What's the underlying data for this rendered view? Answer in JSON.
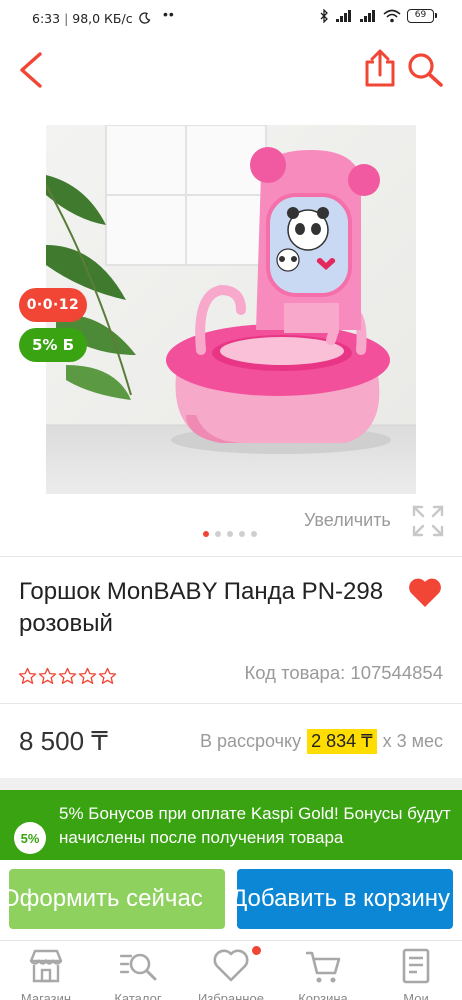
{
  "status_bar": {
    "time": "6:33",
    "network_speed": "98,0 КБ/с",
    "more": "••",
    "battery": "69"
  },
  "product": {
    "title": "Горшок MonBABY Панда PN-298 розовый",
    "sku": "Код товара: 107544854",
    "price": "8 500 ₸",
    "installment_prefix": "В рассрочку",
    "installment_amount": "2 834 ₸",
    "installment_suffix": "х 3 мес",
    "rating_stars": 0,
    "is_favorite": true
  },
  "gallery": {
    "badge_installment": "0·0·12",
    "badge_bonus": "5% Б",
    "zoom_label": "Увеличить",
    "image_count": 5,
    "active_index": 0
  },
  "bonus_banner": {
    "badge": "5%",
    "text": "5% Бонусов при оплате Kaspi Gold! Бонусы будут начислены после получения товара"
  },
  "actions": {
    "buy_now": "Оформить сейчас",
    "add_to_cart": "Добавить в корзину"
  },
  "bottom_nav": {
    "items": [
      {
        "label": "Магазин",
        "icon": "shop-icon"
      },
      {
        "label": "Каталог",
        "icon": "catalog-icon"
      },
      {
        "label": "Избранное",
        "icon": "heart-icon"
      },
      {
        "label": "Корзина",
        "icon": "cart-icon"
      },
      {
        "label": "Мои",
        "icon": "orders-icon"
      }
    ]
  },
  "colors": {
    "brand_red": "#f14635",
    "kaspi_green": "#3aa312",
    "buy_green": "#8ed15f",
    "cart_blue": "#0b87d6",
    "installment_yellow": "#ffdd00"
  }
}
